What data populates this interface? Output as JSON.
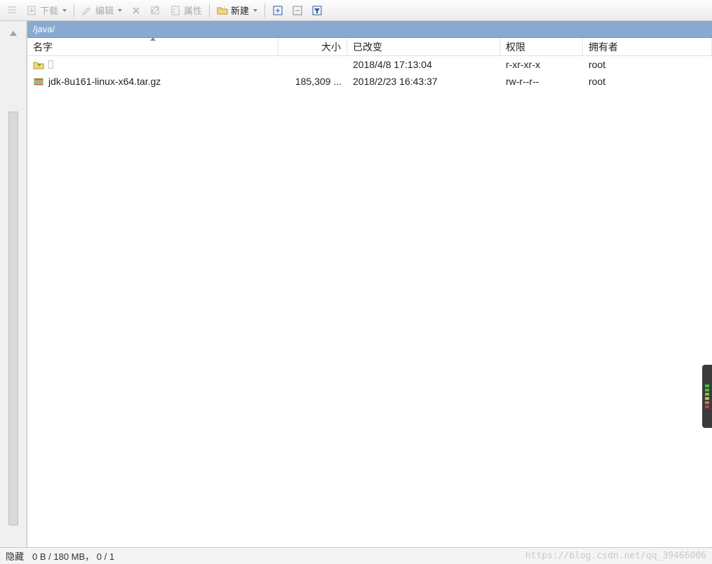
{
  "toolbar": {
    "download_label": "下载",
    "edit_label": "编辑",
    "properties_label": "属性",
    "new_label": "新建"
  },
  "path": "/java/",
  "columns": {
    "name": "名字",
    "size": "大小",
    "modified": "已改变",
    "permissions": "权限",
    "owner": "拥有者"
  },
  "rows": [
    {
      "icon": "folder-up",
      "name": "",
      "size": "",
      "modified": "2018/4/8 17:13:04",
      "permissions": "r-xr-xr-x",
      "owner": "root"
    },
    {
      "icon": "archive",
      "name": "jdk-8u161-linux-x64.tar.gz",
      "size": "185,309 ...",
      "modified": "2018/2/23 16:43:37",
      "permissions": "rw-r--r--",
      "owner": "root"
    }
  ],
  "status": {
    "hidden_label": "隐藏",
    "summary": "0 B / 180 MB， 0 / 1"
  },
  "watermark": "https://blog.csdn.net/qq_39466006"
}
